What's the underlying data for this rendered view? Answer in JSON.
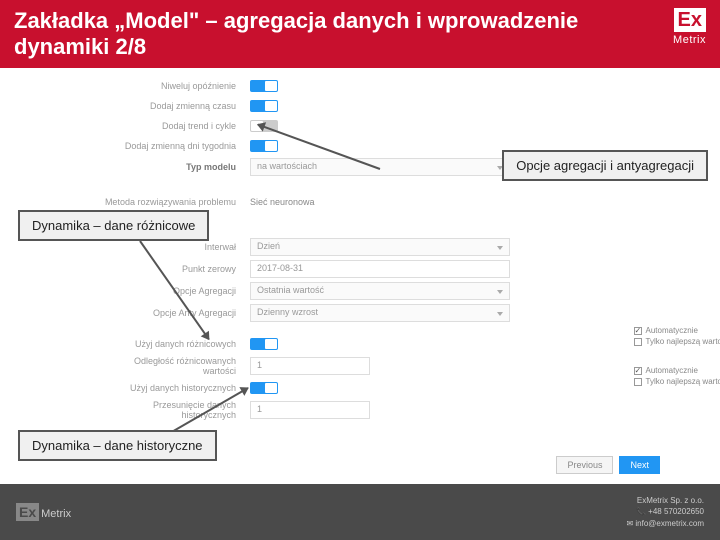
{
  "header": {
    "title": "Zakładka „Model\" – agregacja danych i wprowadzenie dynamiki 2/8",
    "logo_main": "Ex",
    "logo_sub": "Metrix"
  },
  "callouts": {
    "c1": "Opcje agregacji i antyagregacji",
    "c2": "Dynamika – dane różnicowe",
    "c3": "Dynamika – dane historyczne"
  },
  "form": {
    "r1": "Niweluj opóźnienie",
    "r2": "Dodaj zmienną czasu",
    "r3": "Dodaj trend i cykle",
    "r4": "Dodaj zmienną dni tygodnia",
    "r5": "Typ modelu",
    "r5v": "na wartościach",
    "r6": "Metoda rozwiązywania problemu",
    "r6v": "Sieć neuronowa",
    "r8": "Interwał",
    "r8v": "Dzień",
    "r9": "Punkt zerowy",
    "r9v": "2017-08-31",
    "r10": "Opcje Agregacji",
    "r10v": "Ostatnia wartość",
    "r11": "Opcje Anty Agregacji",
    "r11v": "Dzienny wzrost",
    "r12": "Użyj danych różnicowych",
    "r13": "Odległość różnicowanych wartości",
    "r13v": "1",
    "r14": "Użyj danych historycznych",
    "r15": "Przesunięcie danych historycznych",
    "r15v": "1"
  },
  "checks": {
    "auto": "Automatycznie",
    "best": "Tylko najlepszą wartość"
  },
  "nav": {
    "prev": "Previous",
    "next": "Next"
  },
  "footer": {
    "company": "ExMetrix Sp. z o.o.",
    "phone": "+48 570202650",
    "email": "info@exmetrix.com",
    "logo_main": "Ex",
    "logo_sub": "Metrix"
  }
}
